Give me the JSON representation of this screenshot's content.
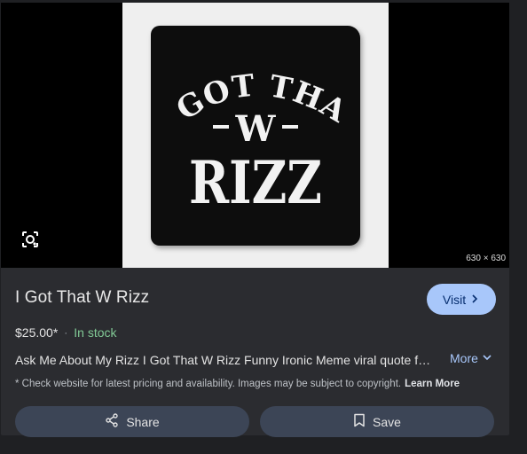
{
  "image": {
    "dimensions": "630 × 630",
    "pillow_text": {
      "line1": "I GOT THAT",
      "line2": "W",
      "line3": "RIZZ"
    }
  },
  "product": {
    "title": "I Got That W Rizz",
    "price": "$25.00*",
    "separator": "·",
    "stock": "In stock",
    "description": "Ask Me About My Rizz I Got That W Rizz Funny Ironic Meme viral quote for…",
    "disclaimer": "* Check website for latest pricing and availability. Images may be subject to copyright.",
    "learn_more": "Learn More"
  },
  "actions": {
    "visit_label": "Visit",
    "more_label": "More",
    "share_label": "Share",
    "save_label": "Save"
  },
  "colors": {
    "panel_bg": "#2b2c30",
    "accent": "#a8c7fa",
    "stock_green": "#81c995",
    "button_bg": "#3c4556"
  },
  "icons": [
    "google-lens-icon",
    "chevron-right-icon",
    "chevron-down-icon",
    "share-icon",
    "bookmark-icon"
  ]
}
